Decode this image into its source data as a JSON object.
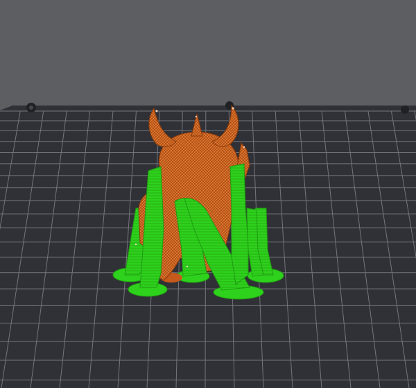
{
  "viewport": {
    "type": "3d-print-preview",
    "background_color": "#5d5e62",
    "bed_color": "#303136",
    "grid_color": "#75767c"
  },
  "bed": {
    "grid": true,
    "mounting_screws": 3
  },
  "model": {
    "name": "",
    "object_color": "#c55a1c",
    "support_color": "#2ed11c",
    "support_pillars": 6
  }
}
